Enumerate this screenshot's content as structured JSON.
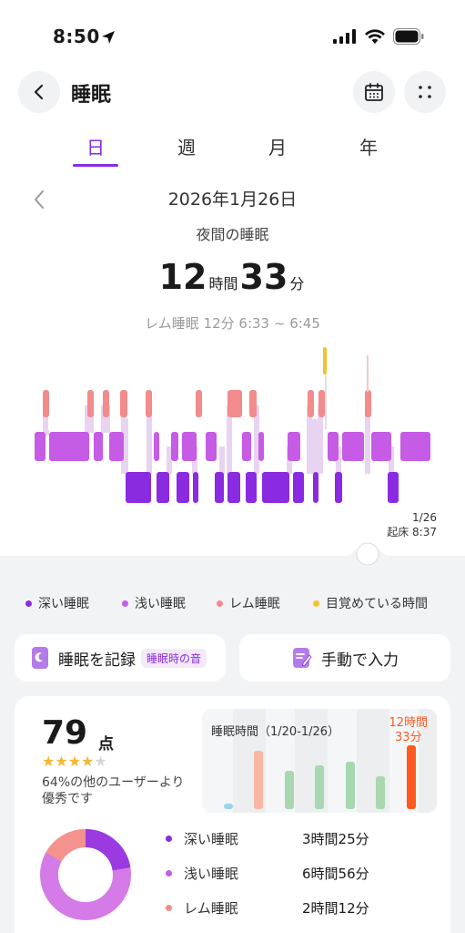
{
  "status_bar": {
    "time": "8:50"
  },
  "header": {
    "title": "睡眠"
  },
  "tabs": [
    {
      "label": "日",
      "active": true
    },
    {
      "label": "週",
      "active": false
    },
    {
      "label": "月",
      "active": false
    },
    {
      "label": "年",
      "active": false
    }
  ],
  "date": "2026年1月26日",
  "section_title": "夜間の睡眠",
  "total": {
    "hours": "12",
    "hours_unit": "時間",
    "minutes": "33",
    "minutes_unit": "分"
  },
  "selected_detail": "レム睡眠 12分 6:33 ~ 6:45",
  "chart_end": {
    "date": "1/26",
    "label": "起床 8:37"
  },
  "colors": {
    "deep": "#8a2be2",
    "light": "#c65be5",
    "rem": "#f28b8b",
    "awake": "#f5c12e",
    "accent": "#8a2be2"
  },
  "legend": [
    {
      "label": "深い睡眠",
      "color": "#8a2be2"
    },
    {
      "label": "浅い睡眠",
      "color": "#c65be5"
    },
    {
      "label": "レム睡眠",
      "color": "#f28b8b"
    },
    {
      "label": "目覚めている時間",
      "color": "#f5c12e"
    }
  ],
  "actions": {
    "record_label": "睡眠を記録",
    "record_tag": "睡眠時の音",
    "manual_label": "手動で入力"
  },
  "score": {
    "value": "79",
    "unit": "点",
    "stars": 4,
    "max_stars": 5,
    "rank_text": "64%の他のユーザーより優秀です"
  },
  "weekly": {
    "title": "睡眠時間（1/20-1/26）",
    "value_line1": "12時間",
    "value_line2": "33分"
  },
  "stages": [
    {
      "name": "深い睡眠",
      "value": "3時間25分",
      "color": "#8a2be2",
      "minutes": 205
    },
    {
      "name": "浅い睡眠",
      "value": "6時間56分",
      "color": "#c65be5",
      "minutes": 416
    },
    {
      "name": "レム睡眠",
      "value": "2時間12分",
      "color": "#f28b8b",
      "minutes": 132
    }
  ]
}
